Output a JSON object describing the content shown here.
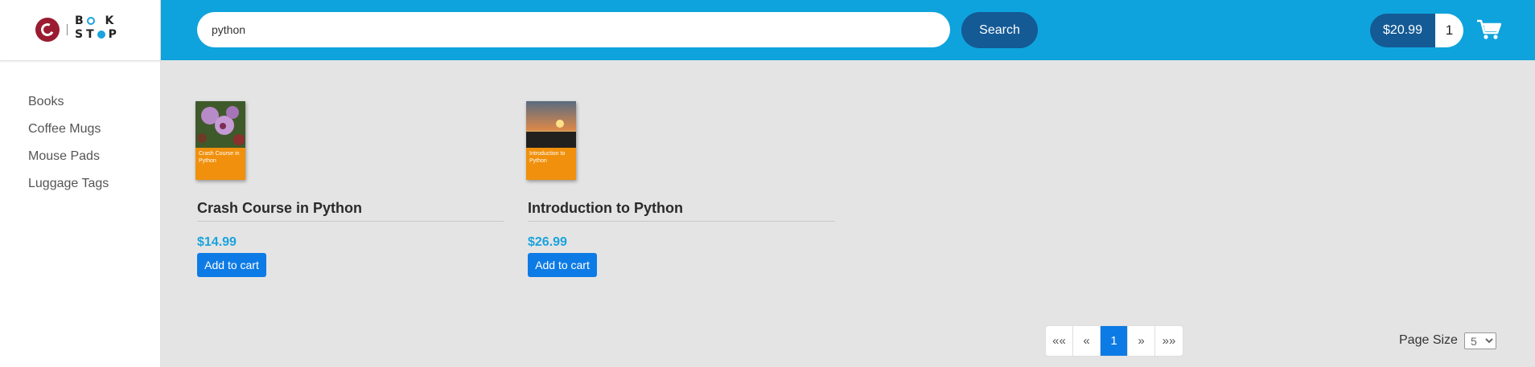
{
  "logo": {
    "line1": "BO K",
    "line2": "ST P"
  },
  "sidebar": {
    "items": [
      {
        "label": "Books"
      },
      {
        "label": "Coffee Mugs"
      },
      {
        "label": "Mouse Pads"
      },
      {
        "label": "Luggage Tags"
      }
    ]
  },
  "header": {
    "search_value": "python",
    "search_button": "Search",
    "cart_total": "$20.99",
    "cart_count": "1",
    "cart_icon": "shopping-cart-icon"
  },
  "products": [
    {
      "title": "Crash Course in Python",
      "cover_title": "Crash Course in Python",
      "price": "$14.99",
      "button": "Add to cart"
    },
    {
      "title": "Introduction to Python",
      "cover_title": "Introduction to Python",
      "price": "$26.99",
      "button": "Add to cart"
    }
  ],
  "pagination": {
    "first": "««",
    "prev": "«",
    "current": "1",
    "next": "»",
    "last": "»»"
  },
  "page_size": {
    "label": "Page Size",
    "value": "5"
  },
  "colors": {
    "header": "#0ea3dc",
    "dark_button": "#145a95",
    "primary": "#0d7be6",
    "price": "#1aa3dd",
    "brand": "#9b1b30"
  }
}
